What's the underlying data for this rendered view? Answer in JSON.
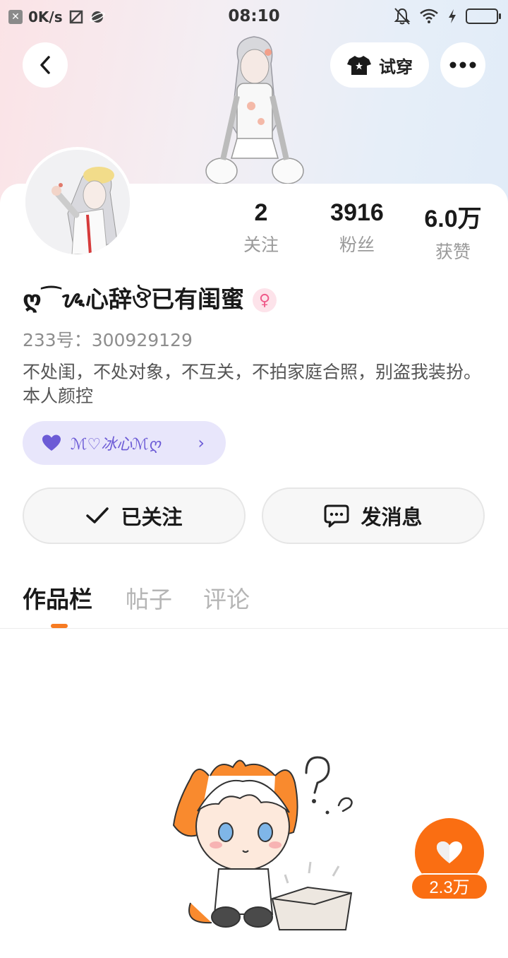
{
  "status_bar": {
    "net_speed": "0K/s",
    "time": "08:10"
  },
  "header": {
    "back_icon": "chevron-left-icon",
    "try_on_label": "试穿",
    "more_icon": "more-dots-icon"
  },
  "stats": [
    {
      "value": "2",
      "label": "关注"
    },
    {
      "value": "3916",
      "label": "粉丝"
    },
    {
      "value": "6.0万",
      "label": "获赞"
    }
  ],
  "profile": {
    "username": "ღ⁀ᝰ心辞ঔ已有闺蜜",
    "gender_icon": "female-icon",
    "uid": "233号：300929129",
    "bio": "不处闺，不处对象，不互关，不拍家庭合照，别盗我装扮。本人颜控",
    "group_tag": "ℳ♡冰心ℳღ"
  },
  "actions": {
    "followed_label": "已关注",
    "message_label": "发消息"
  },
  "tabs": [
    {
      "label": "作品栏",
      "active": true
    },
    {
      "label": "帖子",
      "active": false
    },
    {
      "label": "评论",
      "active": false
    }
  ],
  "like_fab": {
    "count": "2.3万"
  },
  "colors": {
    "accent": "#fa6e12",
    "group_tag_bg": "#e8e6fb",
    "group_tag_text": "#6c5bd6",
    "gender_badge": "#ef5b8a"
  }
}
